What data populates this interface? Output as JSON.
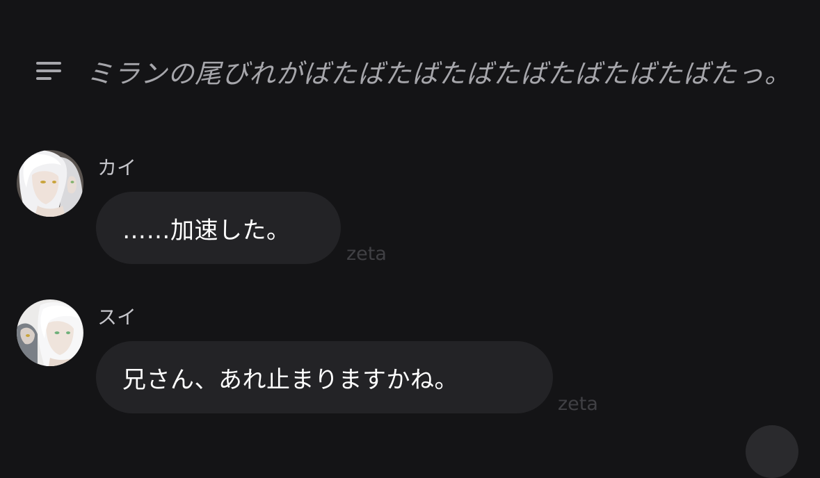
{
  "narration": {
    "icon": "menu-lines-icon",
    "text": "ミランの尾びれがばたばたばたばたばたばたばたばたっ。"
  },
  "messages": [
    {
      "sender": "カイ",
      "text": "……加速した。",
      "watermark": "zeta",
      "avatar": "kai-avatar"
    },
    {
      "sender": "スイ",
      "text": "兄さん、あれ止まりますかね。",
      "watermark": "zeta",
      "avatar": "sui-avatar"
    }
  ],
  "colors": {
    "background": "#141416",
    "bubble": "#232326",
    "narration_text": "#a6a6ab",
    "sender_name": "#c6c6cb",
    "watermark": "#404044"
  }
}
